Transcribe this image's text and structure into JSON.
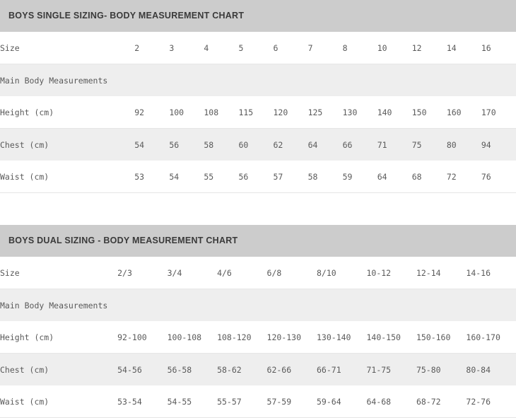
{
  "colors": {
    "title_bar_bg": "#cccccc",
    "title_text": "#3a3a3a",
    "row_stripe_bg": "#eeeeee",
    "row_plain_bg": "#ffffff",
    "body_text": "#5a5a5a",
    "row_border": "#e6e6e6"
  },
  "tables": [
    {
      "title": "BOYS SINGLE SIZING- BODY MEASUREMENT CHART",
      "size_label": "Size",
      "sizes": [
        "2",
        "3",
        "4",
        "5",
        "6",
        "7",
        "8",
        "10",
        "12",
        "14",
        "16"
      ],
      "section_label": "Main Body Measurements",
      "rows": [
        {
          "label": "Height (cm)",
          "values": [
            "92",
            "100",
            "108",
            "115",
            "120",
            "125",
            "130",
            "140",
            "150",
            "160",
            "170"
          ]
        },
        {
          "label": "Chest (cm)",
          "values": [
            "54",
            "56",
            "58",
            "60",
            "62",
            "64",
            "66",
            "71",
            "75",
            "80",
            "94"
          ]
        },
        {
          "label": "Waist (cm)",
          "values": [
            "53",
            "54",
            "55",
            "56",
            "57",
            "58",
            "59",
            "64",
            "68",
            "72",
            "76"
          ]
        }
      ]
    },
    {
      "title": "BOYS DUAL SIZING - BODY MEASUREMENT CHART",
      "size_label": "Size",
      "sizes": [
        "2/3",
        "3/4",
        "4/6",
        "6/8",
        "8/10",
        "10-12",
        "12-14",
        "14-16"
      ],
      "section_label": "Main Body Measurements",
      "rows": [
        {
          "label": "Height (cm)",
          "values": [
            "92-100",
            "100-108",
            "108-120",
            "120-130",
            "130-140",
            "140-150",
            "150-160",
            "160-170"
          ]
        },
        {
          "label": "Chest (cm)",
          "values": [
            "54-56",
            "56-58",
            "58-62",
            "62-66",
            "66-71",
            "71-75",
            "75-80",
            "80-84"
          ]
        },
        {
          "label": "Waist (cm)",
          "values": [
            "53-54",
            "54-55",
            "55-57",
            "57-59",
            "59-64",
            "64-68",
            "68-72",
            "72-76"
          ]
        }
      ]
    }
  ]
}
